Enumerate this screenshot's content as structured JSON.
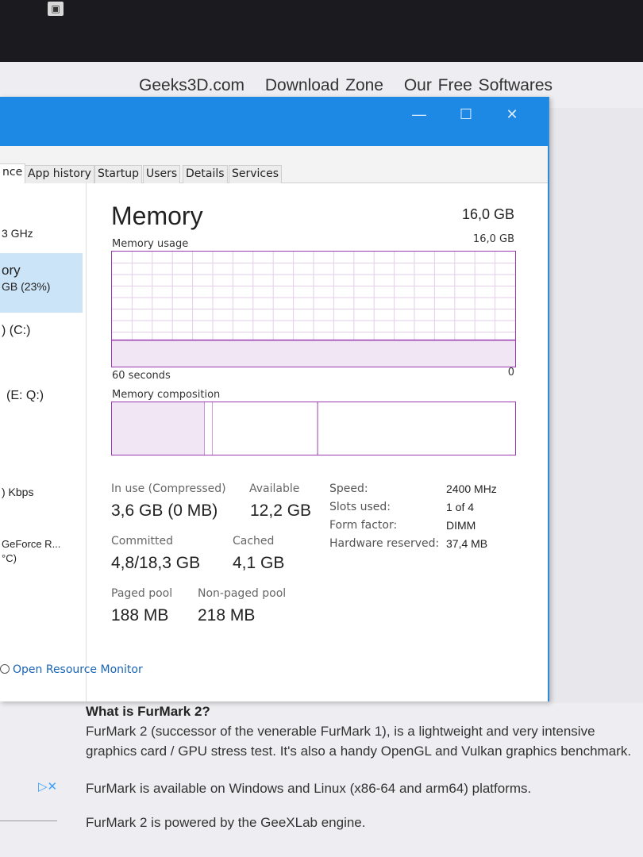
{
  "site_nav": [
    "Geeks3D.com",
    "Download Zone",
    "Our Free Softwares"
  ],
  "window_controls": {
    "minimize": "—",
    "maximize": "☐",
    "close": "✕"
  },
  "tabs": [
    "nce",
    "App history",
    "Startup",
    "Users",
    "Details",
    "Services"
  ],
  "sidebar": [
    {
      "line1": "3 GHz",
      "line2": ""
    },
    {
      "line1": "ory",
      "line2": "GB (23%)"
    },
    {
      "line1": ") (C:)",
      "line2": ""
    },
    {
      "line1": "(E: Q:)",
      "line2": ""
    },
    {
      "line1": ") Kbps",
      "line2": ""
    },
    {
      "line1": "GeForce R...",
      "line2": "°C)"
    }
  ],
  "memory": {
    "title": "Memory",
    "total": "16,0 GB",
    "usage_label": "Memory usage",
    "usage_max": "16,0 GB",
    "time_label": "60 seconds",
    "usage_min": "0",
    "composition_label": "Memory composition",
    "usage_fraction": 0.23,
    "composition": {
      "in_use_fraction": 0.23,
      "modified_fraction": 0.02,
      "standby_fraction": 0.26
    }
  },
  "stats": {
    "in_use_label": "In use (Compressed)",
    "in_use_value": "3,6 GB (0 MB)",
    "available_label": "Available",
    "available_value": "12,2 GB",
    "committed_label": "Committed",
    "committed_value": "4,8/18,3 GB",
    "cached_label": "Cached",
    "cached_value": "4,1 GB",
    "paged_label": "Paged pool",
    "paged_value": "188 MB",
    "nonpaged_label": "Non-paged pool",
    "nonpaged_value": "218 MB"
  },
  "specs": [
    {
      "label": "Speed:",
      "value": "2400 MHz"
    },
    {
      "label": "Slots used:",
      "value": "1 of 4"
    },
    {
      "label": "Form factor:",
      "value": "DIMM"
    },
    {
      "label": "Hardware reserved:",
      "value": "37,4 MB"
    }
  ],
  "resource_monitor": "Open Resource Monitor",
  "article": {
    "heading": "What is FurMark 2?",
    "para1": "FurMark 2 (successor of the venerable FurMark 1), is a lightweight and very intensive graphics card / GPU stress test. It's also a handy OpenGL and Vulkan graphics benchmark.",
    "para2": "FurMark is available on Windows and Linux (x86-64 and arm64) platforms.",
    "para3": "FurMark 2 is powered by the GeeXLab engine."
  },
  "colors": {
    "titlebar": "#1e88e5",
    "graph_border": "#9b3ab0",
    "selected_side": "#cce4f7"
  }
}
